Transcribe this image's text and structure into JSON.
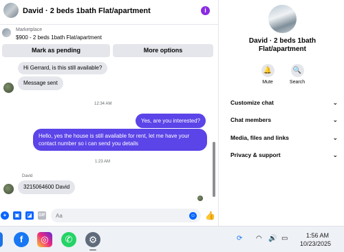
{
  "header": {
    "title": "David · 2 beds 1bath Flat/apartment",
    "info_icon": "info-icon"
  },
  "listing": {
    "source": "Marketplace",
    "description": "$900 - 2 beds 1bath Flat/apartment",
    "pending_button": "Mark as pending",
    "more_button": "More options"
  },
  "messages": {
    "m1": "Hi Gerrard, is this still available?",
    "m2": "Message sent",
    "t1": "12:34 AM",
    "m3": "Yes, are you interested?",
    "m4": "Hello, yes the house is still available for rent, let me have your contact number so i can send you details",
    "t2": "1:23 AM",
    "sender": "David",
    "m5": "3215064600 David"
  },
  "composer": {
    "placeholder": "Aa"
  },
  "side_panel": {
    "name": "David · 2 beds 1bath Flat/apartment",
    "mute_label": "Mute",
    "search_label": "Search",
    "rows": [
      "Customize chat",
      "Chat members",
      "Media, files and links",
      "Privacy & support"
    ]
  },
  "taskbar": {
    "time": "1:56 AM",
    "date": "10/23/2025"
  },
  "colors": {
    "accent": "#5b44e8",
    "brand": "#0866ff",
    "info": "#8a2be2"
  }
}
